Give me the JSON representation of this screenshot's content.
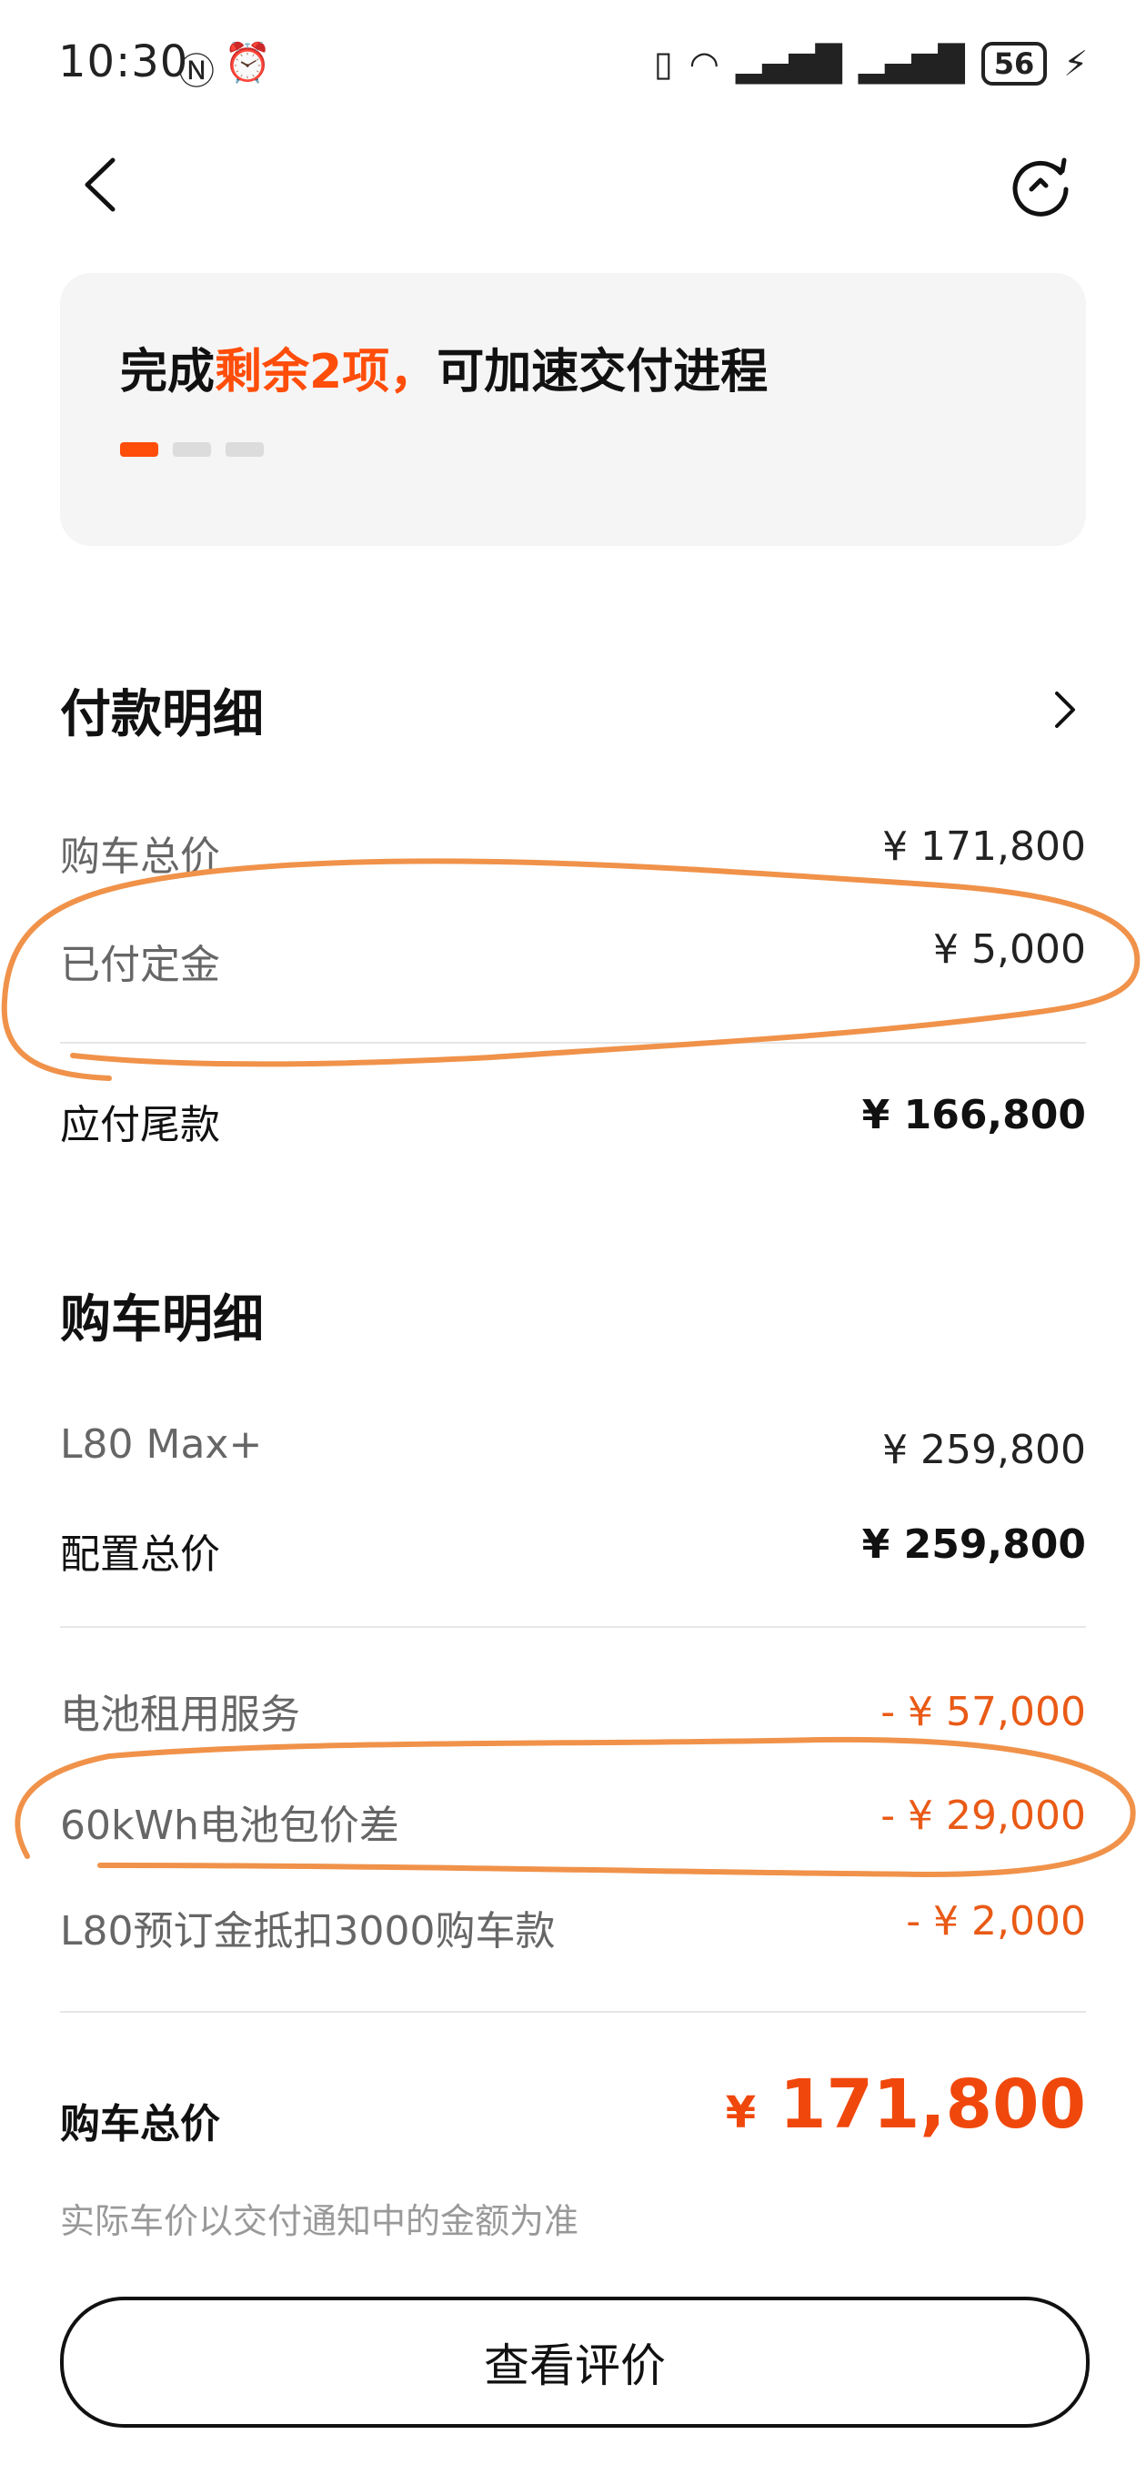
{
  "status_bar": {
    "time": "10:30",
    "icons": [
      "nfc-icon",
      "alarm-icon",
      "vibrate-icon",
      "wifi-icon",
      "signal-icon",
      "signal-icon",
      "battery-icon",
      "charging-icon"
    ],
    "battery": "56"
  },
  "banner": {
    "title_prefix": "完成",
    "title_highlight": "剩余2项，",
    "title_suffix": "可加速交付进程",
    "pages": 3,
    "active_page": 1,
    "accent_color": "#ff4d0a"
  },
  "payment": {
    "title": "付款明细",
    "rows": [
      {
        "label": "购车总价",
        "value": "¥ 171,800"
      },
      {
        "label": "已付定金",
        "value": "¥ 5,000"
      }
    ],
    "balance": {
      "label": "应付尾款",
      "value": "¥ 166,800"
    }
  },
  "purchase": {
    "title": "购车明细",
    "model": {
      "label": "L80 Max+",
      "value": "¥ 259,800"
    },
    "config_total": {
      "label": "配置总价",
      "value": "¥ 259,800"
    },
    "deductions": [
      {
        "label": "电池租用服务",
        "value": "- ¥ 57,000"
      },
      {
        "label": "60kWh电池包价差",
        "value": "- ¥ 29,000"
      },
      {
        "label": "L80预订金抵扣3000购车款",
        "value": "- ¥ 2,000"
      }
    ],
    "total": {
      "label": "购车总价",
      "currency": "¥",
      "value": "171,800"
    },
    "note": "实际车价以交付通知中的金额为准"
  },
  "actions": {
    "evaluate_label": "查看评价"
  },
  "colors": {
    "orange_price": "#e95a16",
    "total_price": "#f0480c",
    "annotation_marker": "#f0924a"
  }
}
